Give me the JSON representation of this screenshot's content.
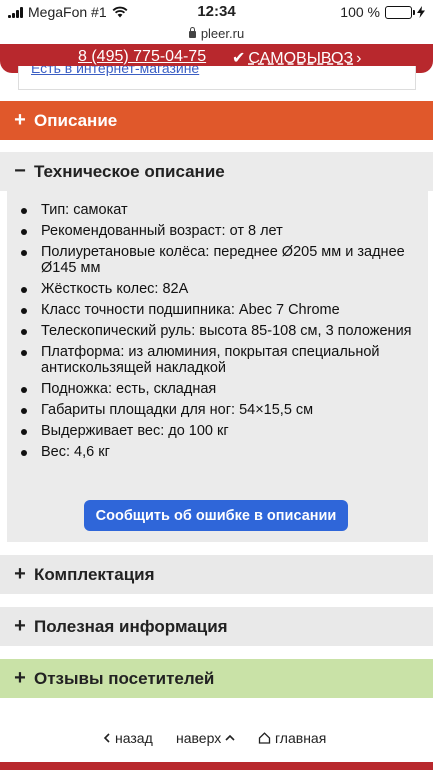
{
  "status_bar": {
    "carrier": "MegaFon #1",
    "time": "12:34",
    "battery": "100 %",
    "battery_level": 1.0
  },
  "browser": {
    "url": "pleer.ru"
  },
  "header": {
    "phone": "8 (495) 775-04-75",
    "pickup": "САМОВЫВОЗ"
  },
  "cut_link": "Есть в интернет-магазине",
  "sections": {
    "description": {
      "sign": "+",
      "label": "Описание"
    },
    "tech": {
      "sign": "−",
      "label": "Техническое описание"
    },
    "complect": {
      "sign": "+",
      "label": "Комплектация"
    },
    "useful": {
      "sign": "+",
      "label": "Полезная информация"
    },
    "reviews": {
      "sign": "+",
      "label": "Отзывы посетителей"
    }
  },
  "specs": [
    "Тип: самокат",
    "Рекомендованный возраст: от 8 лет",
    "Полиуретановые колёса: переднее Ø205 мм и заднее Ø145 мм",
    "Жёсткость колес: 82A",
    "Класс точности подшипника: Abec 7 Chrome",
    "Телескопический руль: высота 85-108 см, 3 положения",
    "Платформа: из алюминия, покрытая специальной антискользящей накладкой",
    "Подножка: есть, складная",
    "Габариты площадки для ног: 54×15,5 см",
    "Выдерживает вес: до 100 кг",
    "Вес: 4,6 кг"
  ],
  "report_button": "Сообщить об ошибке в описании",
  "bottom_nav": {
    "back": "назад",
    "up": "наверх",
    "home": "главная"
  },
  "colors": {
    "brand_red": "#b8282d",
    "description_orange": "#e0582b",
    "reviews_green": "#c9e2a7",
    "button_blue": "#2f66d9"
  }
}
